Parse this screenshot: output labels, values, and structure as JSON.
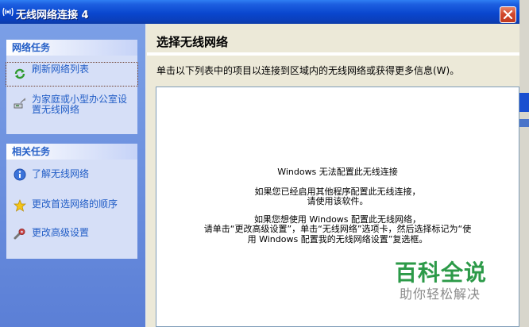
{
  "window": {
    "title": "无线网络连接 4"
  },
  "sidebar": {
    "network_tasks": {
      "header": "网络任务",
      "items": [
        {
          "label_lines": [
            "刷新网络列表"
          ],
          "icon": "refresh-icon"
        },
        {
          "label_lines": [
            "为家庭或小型办公室设",
            "置无线网络"
          ],
          "icon": "network-setup-icon"
        }
      ]
    },
    "related_tasks": {
      "header": "相关任务",
      "items": [
        {
          "label": "了解无线网络",
          "icon": "info-icon"
        },
        {
          "label": "更改首选网络的顺序",
          "icon": "star-icon"
        },
        {
          "label": "更改高级设置",
          "icon": "settings-icon"
        }
      ]
    }
  },
  "main": {
    "heading": "选择无线网络",
    "description": "单击以下列表中的项目以连接到区域内的无线网络或获得更多信息(W)。",
    "message_lines": [
      "Windows 无法配置此无线连接",
      "如果您已经启用其他程序配置此无线连接，",
      "请使用该软件。",
      "如果您想使用 Windows 配置此无线网络，",
      "请单击“更改高级设置”，单击“无线网络”选项卡，然后选择标记为“使",
      "用 Windows 配置我的无线网络设置”复选框。"
    ]
  },
  "watermark": {
    "brand": "百科全说",
    "slogan": "助你轻松解决"
  },
  "colors": {
    "titlebar": "#0a47cf",
    "link": "#215dc6",
    "sidebar": "#6f93e0",
    "watermark": "#2c9a48"
  }
}
